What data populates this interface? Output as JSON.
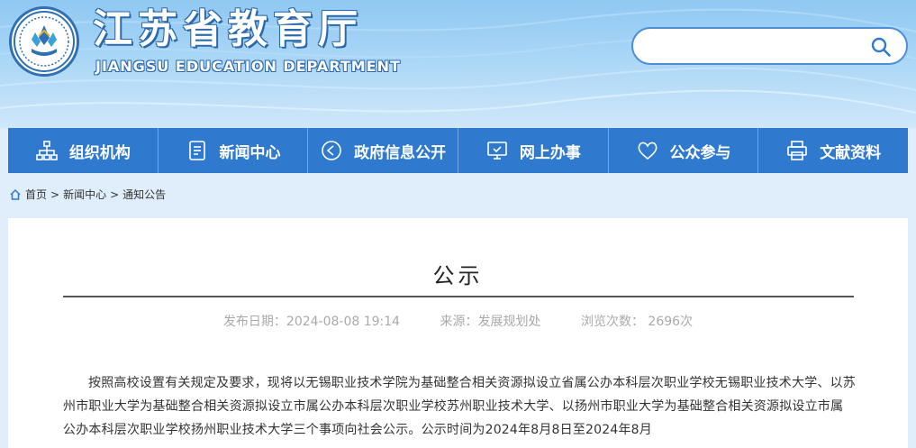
{
  "header": {
    "title_cn": "江苏省教育厅",
    "title_en": "JIANGSU EDUCATION DEPARTMENT",
    "logo_icon": "jiangsu-education-emblem",
    "search_placeholder": "",
    "search_icon": "search-icon"
  },
  "nav": {
    "items": [
      {
        "label": "组织机构",
        "icon": "org-chart-icon"
      },
      {
        "label": "新闻中心",
        "icon": "document-icon"
      },
      {
        "label": "政府信息公开",
        "icon": "speaker-icon"
      },
      {
        "label": "网上办事",
        "icon": "monitor-icon"
      },
      {
        "label": "公众参与",
        "icon": "heart-icon"
      },
      {
        "label": "文献资料",
        "icon": "printer-icon"
      }
    ]
  },
  "breadcrumb": {
    "icon": "home-icon",
    "home": "首页",
    "level1": "新闻中心",
    "level2": "通知公告",
    "sep": ">"
  },
  "article": {
    "title": "公示",
    "publish_date": "发布日期：2024-08-08 19:14",
    "source": "来源：发展规划处",
    "views": "浏览次数：  2696次",
    "body": "按照高校设置有关规定及要求，现将以无锡职业技术学院为基础整合相关资源拟设立省属公办本科层次职业学校无锡职业技术大学、以苏州市职业大学为基础整合相关资源拟设立市属公办本科层次职业学校苏州职业技术大学、以扬州市职业大学为基础整合相关资源拟设立市属公办本科层次职业学校扬州职业技术大学三个事项向社会公示。公示时间为2024年8月8日至2024年8月"
  },
  "colors": {
    "nav_bg": "#2f79cf",
    "header_blue": "#2a68ad",
    "page_bg": "#dfeefa"
  }
}
